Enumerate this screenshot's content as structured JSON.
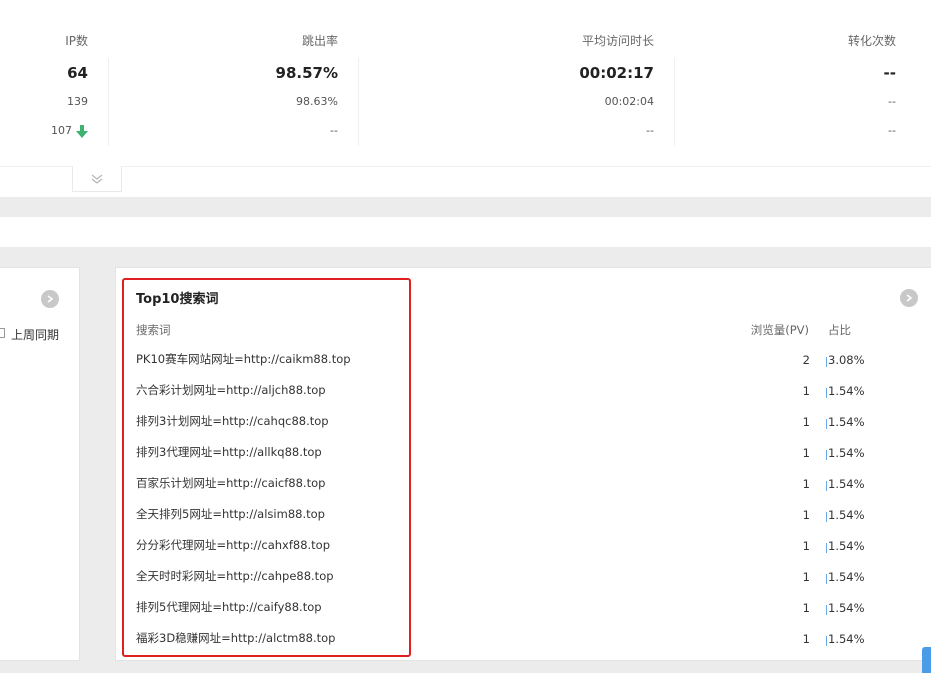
{
  "stats": {
    "columns": [
      {
        "header": "IP数",
        "value": "64",
        "previous": "139",
        "compare": "107"
      },
      {
        "header": "跳出率",
        "value": "98.57%",
        "previous": "98.63%",
        "compare": "--"
      },
      {
        "header": "平均访问时长",
        "value": "00:02:17",
        "previous": "00:02:04",
        "compare": "--"
      },
      {
        "header": "转化次数",
        "value": "--",
        "previous": "--",
        "compare": "--"
      }
    ],
    "down_arrow_color": "#3cb371"
  },
  "left_panel": {
    "legend_label": "上周同期"
  },
  "search_terms": {
    "title": "Top10搜索词",
    "columns": {
      "term": "搜索词",
      "pv": "浏览量(PV)",
      "pct": "占比"
    },
    "rows": [
      {
        "term": "PK10赛车网站网址=http://caikm88.top",
        "pv": "2",
        "pct": "3.08%"
      },
      {
        "term": "六合彩计划网址=http://aljch88.top",
        "pv": "1",
        "pct": "1.54%"
      },
      {
        "term": "排列3计划网址=http://cahqc88.top",
        "pv": "1",
        "pct": "1.54%"
      },
      {
        "term": "排列3代理网址=http://allkq88.top",
        "pv": "1",
        "pct": "1.54%"
      },
      {
        "term": "百家乐计划网址=http://caicf88.top",
        "pv": "1",
        "pct": "1.54%"
      },
      {
        "term": "全天排列5网址=http://alsim88.top",
        "pv": "1",
        "pct": "1.54%"
      },
      {
        "term": "分分彩代理网址=http://cahxf88.top",
        "pv": "1",
        "pct": "1.54%"
      },
      {
        "term": "全天时时彩网址=http://cahpe88.top",
        "pv": "1",
        "pct": "1.54%"
      },
      {
        "term": "排列5代理网址=http://caify88.top",
        "pv": "1",
        "pct": "1.54%"
      },
      {
        "term": "福彩3D稳赚网址=http://alctm88.top",
        "pv": "1",
        "pct": "1.54%"
      }
    ]
  },
  "colors": {
    "highlight": "#e02020",
    "accent": "#4a9be8",
    "background_band": "#ececec"
  }
}
